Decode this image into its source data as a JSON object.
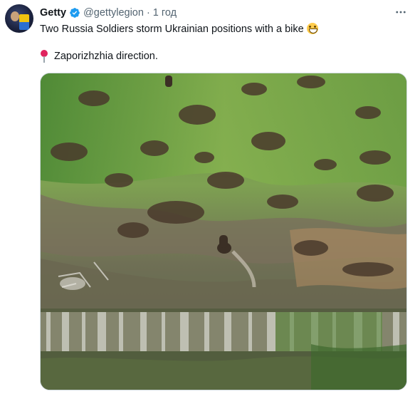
{
  "tweet": {
    "author_name": "Getty",
    "handle": "@gettylegion",
    "separator": "·",
    "timestamp": "1 год",
    "text_line1": "Two Russia Soldiers storm Ukrainian positions with a bike",
    "text_line2": "Zaporizhzhia direction."
  },
  "icons": {
    "verified": "verified-badge-icon",
    "more": "more-options-icon",
    "emoji": "grinning-face-emoji-icon",
    "pin": "round-pushpin-emoji-icon"
  },
  "colors": {
    "verified": "#1d9bf0",
    "text": "#0f1419",
    "secondary_text": "#536471",
    "border": "#cfd9de"
  }
}
